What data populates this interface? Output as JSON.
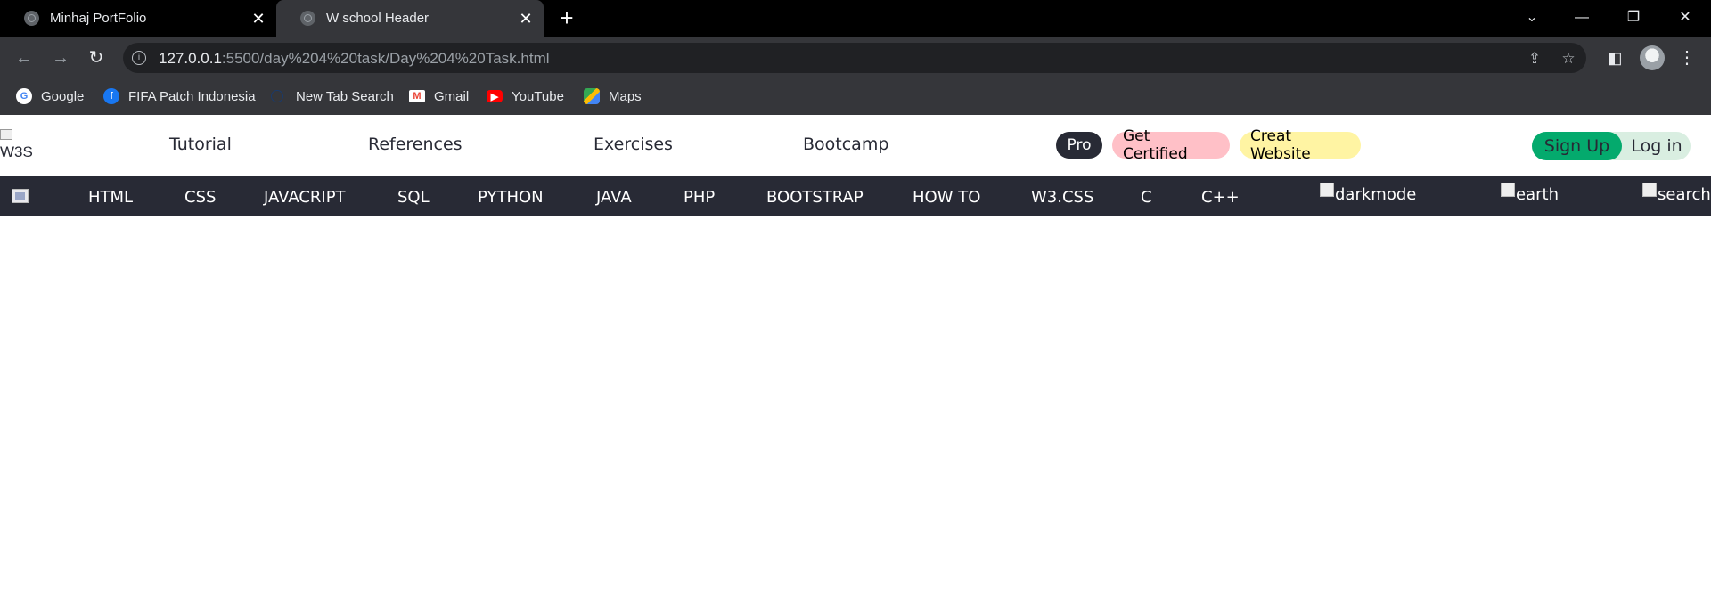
{
  "browser": {
    "tabs": [
      {
        "title": "Minhaj PortFolio",
        "active": false
      },
      {
        "title": "W school Header",
        "active": true
      }
    ],
    "address": {
      "host": "127.0.0.1",
      "path": ":5500/day%204%20task/Day%204%20Task.html"
    },
    "bookmarks": [
      {
        "label": "Google",
        "icon": "google-icon"
      },
      {
        "label": "FIFA Patch Indonesia",
        "icon": "facebook-icon"
      },
      {
        "label": "New Tab Search",
        "icon": "search-icon"
      },
      {
        "label": "Gmail",
        "icon": "gmail-icon"
      },
      {
        "label": "YouTube",
        "icon": "youtube-icon"
      },
      {
        "label": "Maps",
        "icon": "maps-icon"
      }
    ]
  },
  "site": {
    "logo_alt": "W3S",
    "top_links": [
      "Tutorial",
      "References",
      "Exercises",
      "Bootcamp"
    ],
    "pills": {
      "pro": "Pro",
      "certified": "Get Certified",
      "website": "Creat Website"
    },
    "auth": {
      "signup": "Sign Up",
      "login": "Log in"
    },
    "sub_links": [
      "HTML",
      "CSS",
      "JAVACRIPT",
      "SQL",
      "PYTHON",
      "JAVA",
      "PHP",
      "BOOTSTRAP",
      "HOW TO",
      "W3.CSS",
      "C",
      "C++"
    ],
    "broken_images": {
      "darkmode": "darkmode",
      "earth": "earth",
      "search": "search"
    },
    "colors": {
      "dark": "#282a35",
      "green": "#04aa6d",
      "pink": "#ffc0c7",
      "yellow": "#fff4a3",
      "mint": "#d9eee1"
    }
  }
}
